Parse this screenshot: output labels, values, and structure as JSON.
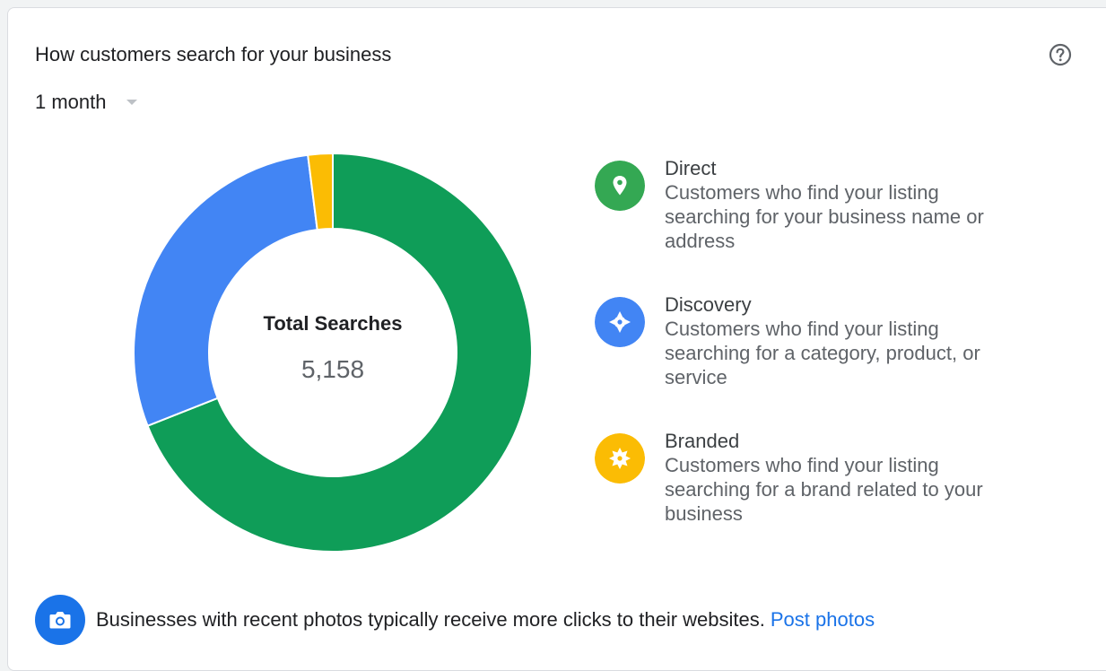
{
  "card": {
    "title": "How customers search for your business",
    "help_icon": "help-circle-icon"
  },
  "period": {
    "selected": "1 month",
    "icon": "caret-down-icon"
  },
  "chart_data": {
    "type": "pie",
    "variant": "donut",
    "center_label": "Total Searches",
    "center_value": "5,158",
    "slices": [
      {
        "name": "Direct",
        "share": 0.69,
        "color": "#0f9d58"
      },
      {
        "name": "Discovery",
        "share": 0.29,
        "color": "#4285f4"
      },
      {
        "name": "Branded",
        "share": 0.02,
        "color": "#fbbc04"
      }
    ]
  },
  "legend": [
    {
      "name": "Direct",
      "desc_lines": [
        "Customers who find your listing",
        "searching for your business name or",
        "address"
      ],
      "icon": "location-pin-icon",
      "color": "#34a853"
    },
    {
      "name": "Discovery",
      "desc_lines": [
        "Customers who find your listing",
        "searching for a category, product, or",
        "service"
      ],
      "icon": "compass-icon",
      "color": "#4285f4"
    },
    {
      "name": "Branded",
      "desc_lines": [
        "Customers who find your listing",
        "searching for a brand related to your",
        "business"
      ],
      "icon": "badge-icon",
      "color": "#fbbc04"
    }
  ],
  "footer": {
    "icon": "camera-icon",
    "text": "Businesses with recent photos typically receive more clicks to their websites.",
    "link": "Post photos"
  }
}
